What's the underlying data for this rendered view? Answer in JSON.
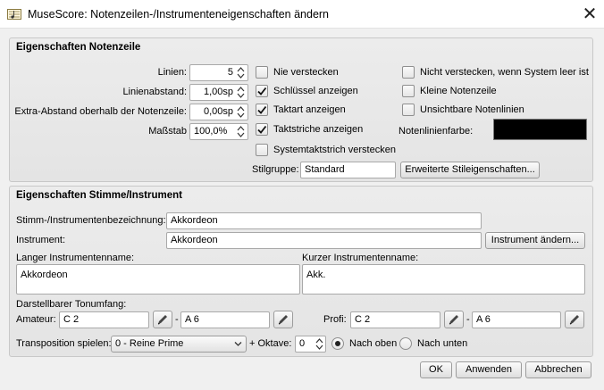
{
  "window": {
    "title": "MuseScore: Notenzeilen-/Instrumenteneigenschaften ändern"
  },
  "staff": {
    "title": "Eigenschaften Notenzeile",
    "lines_label": "Linien:",
    "lines_value": "5",
    "distance_label": "Linienabstand:",
    "distance_value": "1,00sp",
    "extra_label": "Extra-Abstand oberhalb der Notenzeile:",
    "extra_value": "0,00sp",
    "scale_label": "Maßstab",
    "scale_value": "100,0%",
    "never_hide": "Nie verstecken",
    "never_hide_checked": false,
    "show_clef": "Schlüssel anzeigen",
    "show_clef_checked": true,
    "show_timesig": "Taktart anzeigen",
    "show_timesig_checked": true,
    "show_barlines": "Taktstriche anzeigen",
    "show_barlines_checked": true,
    "hide_system_barline": "Systemtaktstrich verstecken",
    "hide_system_barline_checked": false,
    "not_hide_empty": "Nicht verstecken, wenn System leer ist",
    "not_hide_empty_checked": false,
    "small_staff": "Kleine Notenzeile",
    "small_staff_checked": false,
    "invisible_lines": "Unsichtbare Notenlinien",
    "invisible_lines_checked": false,
    "color_label": "Notenlinienfarbe:",
    "color_value": "#000000",
    "style_group_label": "Stilgruppe:",
    "style_group_value": "Standard",
    "advanced_button": "Erweiterte Stileigenschaften..."
  },
  "part": {
    "title": "Eigenschaften Stimme/Instrument",
    "part_name_label": "Stimm-/Instrumentenbezeichnung:",
    "part_name_value": "Akkordeon",
    "instrument_label": "Instrument:",
    "instrument_value": "Akkordeon",
    "change_instrument_button": "Instrument ändern...",
    "long_name_label": "Langer Instrumentenname:",
    "long_name_value": "Akkordeon",
    "short_name_label": "Kurzer Instrumentenname:",
    "short_name_value": "Akk.",
    "range_label": "Darstellbarer Tonumfang:",
    "amateur_label": "Amateur:",
    "amateur_low": "C 2",
    "amateur_high": "A 6",
    "pro_label": "Profi:",
    "pro_low": "C 2",
    "pro_high": "A 6",
    "dash": "-",
    "transpose_label": "Transposition spielen:",
    "transpose_value": "0 - Reine Prime",
    "octave_label": "+ Oktave:",
    "octave_value": "0",
    "up_label": "Nach oben",
    "up_selected": true,
    "down_label": "Nach unten",
    "down_selected": false
  },
  "buttons": {
    "ok": "OK",
    "apply": "Anwenden",
    "cancel": "Abbrechen"
  }
}
